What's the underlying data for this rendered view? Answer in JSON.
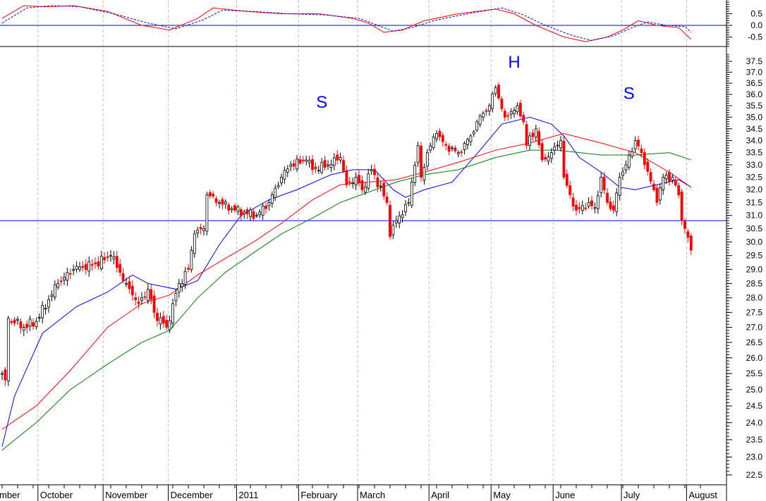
{
  "chart_data": {
    "type": "candlestick",
    "scale": "log",
    "x_unit": "trading day index (0 = mid-September 2010)",
    "months": [
      {
        "label": "mber",
        "day": -1
      },
      {
        "label": "October",
        "day": 12
      },
      {
        "label": "November",
        "day": 33
      },
      {
        "label": "December",
        "day": 54
      },
      {
        "label": "2011",
        "day": 76
      },
      {
        "label": "February",
        "day": 96
      },
      {
        "label": "March",
        "day": 115
      },
      {
        "label": "April",
        "day": 138
      },
      {
        "label": "May",
        "day": 158
      },
      {
        "label": "June",
        "day": 178
      },
      {
        "label": "July",
        "day": 200
      },
      {
        "label": "August",
        "day": 221
      }
    ],
    "price_axis": {
      "min": 22.5,
      "max": 37.5,
      "step": 0.5,
      "labels": [
        "37.5",
        "37.0",
        "36.5",
        "36.0",
        "35.5",
        "35.0",
        "34.5",
        "34.0",
        "33.5",
        "33.0",
        "32.5",
        "32.0",
        "31.5",
        "31.0",
        "30.5",
        "30.0",
        "29.5",
        "29.0",
        "28.5",
        "28.0",
        "27.5",
        "27.0",
        "26.5",
        "26.0",
        "25.5",
        "25.0",
        "24.5",
        "24.0",
        "23.5",
        "23.0",
        "22.5"
      ]
    },
    "oscillator_axis": {
      "labels": [
        "0.5",
        "0.0",
        "-0.5"
      ],
      "values": [
        0.5,
        0,
        -0.5
      ]
    },
    "support_level": 30.8,
    "close_anchors": [
      [
        0,
        25.5
      ],
      [
        1,
        25.3
      ],
      [
        2,
        27.3
      ],
      [
        7,
        27.0
      ],
      [
        11,
        27.2
      ],
      [
        18,
        28.5
      ],
      [
        23,
        29.0
      ],
      [
        30,
        29.2
      ],
      [
        35,
        29.5
      ],
      [
        40,
        28.5
      ],
      [
        44,
        27.8
      ],
      [
        47,
        28.3
      ],
      [
        49,
        27.5
      ],
      [
        53,
        27.0
      ],
      [
        55,
        27.8
      ],
      [
        57,
        28.5
      ],
      [
        60,
        29.0
      ],
      [
        62,
        30.3
      ],
      [
        65,
        30.5
      ],
      [
        66,
        31.8
      ],
      [
        70,
        31.5
      ],
      [
        75,
        31.2
      ],
      [
        82,
        31.0
      ],
      [
        86,
        31.5
      ],
      [
        90,
        32.5
      ],
      [
        93,
        33.0
      ],
      [
        98,
        33.2
      ],
      [
        100,
        32.8
      ],
      [
        105,
        33.0
      ],
      [
        109,
        33.3
      ],
      [
        111,
        32.2
      ],
      [
        114,
        32.5
      ],
      [
        116,
        32.0
      ],
      [
        119,
        32.8
      ],
      [
        124,
        31.5
      ],
      [
        125,
        30.2
      ],
      [
        127,
        30.8
      ],
      [
        131,
        31.5
      ],
      [
        132,
        32.3
      ],
      [
        134,
        33.8
      ],
      [
        135,
        32.5
      ],
      [
        137,
        33.5
      ],
      [
        140,
        34.3
      ],
      [
        143,
        33.8
      ],
      [
        147,
        33.5
      ],
      [
        151,
        34.2
      ],
      [
        153,
        34.8
      ],
      [
        157,
        35.5
      ],
      [
        159,
        36.3
      ],
      [
        162,
        35.0
      ],
      [
        166,
        35.5
      ],
      [
        168,
        34.8
      ],
      [
        169,
        33.8
      ],
      [
        172,
        34.5
      ],
      [
        174,
        33.2
      ],
      [
        177,
        33.5
      ],
      [
        180,
        34.0
      ],
      [
        181,
        32.5
      ],
      [
        183,
        31.8
      ],
      [
        185,
        31.2
      ],
      [
        189,
        31.5
      ],
      [
        191,
        31.3
      ],
      [
        193,
        32.5
      ],
      [
        195,
        31.5
      ],
      [
        197,
        31.2
      ],
      [
        199,
        32.5
      ],
      [
        201,
        33.0
      ],
      [
        204,
        34.0
      ],
      [
        206,
        33.5
      ],
      [
        207,
        33.0
      ],
      [
        210,
        32.0
      ],
      [
        211,
        31.5
      ],
      [
        213,
        32.5
      ],
      [
        216,
        32.5
      ],
      [
        218,
        31.8
      ],
      [
        219,
        30.8
      ],
      [
        220,
        30.5
      ],
      [
        222,
        29.7
      ]
    ],
    "series": [
      {
        "name": "short moving average",
        "color": "#0000ff",
        "points": [
          [
            0,
            23.3
          ],
          [
            4,
            24.8
          ],
          [
            13,
            26.8
          ],
          [
            24,
            27.7
          ],
          [
            34,
            28.2
          ],
          [
            42,
            28.8
          ],
          [
            47,
            28.5
          ],
          [
            56,
            28.3
          ],
          [
            63,
            28.6
          ],
          [
            70,
            29.9
          ],
          [
            77,
            31.0
          ],
          [
            86,
            31.6
          ],
          [
            95,
            32.0
          ],
          [
            106,
            32.6
          ],
          [
            113,
            32.8
          ],
          [
            120,
            32.8
          ],
          [
            126,
            32.0
          ],
          [
            130,
            31.7
          ],
          [
            136,
            32.0
          ],
          [
            145,
            32.3
          ],
          [
            154,
            33.6
          ],
          [
            161,
            34.7
          ],
          [
            170,
            35.0
          ],
          [
            177,
            34.7
          ],
          [
            181,
            34.2
          ],
          [
            186,
            33.3
          ],
          [
            193,
            32.7
          ],
          [
            199,
            32.1
          ],
          [
            204,
            32.0
          ],
          [
            211,
            32.2
          ],
          [
            218,
            32.4
          ],
          [
            222,
            32.1
          ]
        ]
      },
      {
        "name": "medium moving average",
        "color": "#ff0000",
        "points": [
          [
            0,
            23.8
          ],
          [
            11,
            24.5
          ],
          [
            22,
            25.6
          ],
          [
            34,
            27.0
          ],
          [
            45,
            27.8
          ],
          [
            54,
            28.1
          ],
          [
            63,
            28.8
          ],
          [
            72,
            29.4
          ],
          [
            81,
            30.0
          ],
          [
            90,
            30.7
          ],
          [
            100,
            31.6
          ],
          [
            109,
            32.2
          ],
          [
            118,
            32.3
          ],
          [
            127,
            32.4
          ],
          [
            136,
            32.7
          ],
          [
            147,
            33.1
          ],
          [
            159,
            33.6
          ],
          [
            170,
            33.9
          ],
          [
            181,
            34.3
          ],
          [
            193,
            33.9
          ],
          [
            204,
            33.5
          ],
          [
            215,
            32.7
          ],
          [
            222,
            32.1
          ]
        ]
      },
      {
        "name": "long moving average",
        "color": "#008000",
        "points": [
          [
            0,
            23.2
          ],
          [
            11,
            24.0
          ],
          [
            22,
            25.0
          ],
          [
            34,
            25.8
          ],
          [
            45,
            26.5
          ],
          [
            54,
            26.9
          ],
          [
            63,
            28.0
          ],
          [
            72,
            28.9
          ],
          [
            81,
            29.6
          ],
          [
            90,
            30.3
          ],
          [
            100,
            30.9
          ],
          [
            109,
            31.5
          ],
          [
            118,
            31.9
          ],
          [
            127,
            32.3
          ],
          [
            136,
            32.6
          ],
          [
            147,
            32.8
          ],
          [
            159,
            33.3
          ],
          [
            170,
            33.6
          ],
          [
            179,
            33.6
          ],
          [
            193,
            33.4
          ],
          [
            204,
            33.4
          ],
          [
            215,
            33.5
          ],
          [
            222,
            33.2
          ]
        ]
      }
    ],
    "oscillator": [
      {
        "name": "oscillator",
        "color": "#ff0000",
        "style": "solid",
        "points": [
          [
            0,
            0.3
          ],
          [
            7,
            0.85
          ],
          [
            14,
            0.8
          ],
          [
            23,
            0.85
          ],
          [
            34,
            0.6
          ],
          [
            45,
            0.0
          ],
          [
            54,
            -0.2
          ],
          [
            63,
            0.3
          ],
          [
            68,
            0.75
          ],
          [
            79,
            0.6
          ],
          [
            90,
            0.5
          ],
          [
            102,
            0.5
          ],
          [
            113,
            0.3
          ],
          [
            118,
            0.1
          ],
          [
            123,
            -0.3
          ],
          [
            129,
            -0.2
          ],
          [
            136,
            0.2
          ],
          [
            147,
            0.5
          ],
          [
            159,
            0.7
          ],
          [
            165,
            0.5
          ],
          [
            172,
            0.0
          ],
          [
            181,
            -0.5
          ],
          [
            188,
            -0.7
          ],
          [
            195,
            -0.5
          ],
          [
            200,
            -0.2
          ],
          [
            205,
            0.2
          ],
          [
            211,
            0.0
          ],
          [
            218,
            -0.1
          ],
          [
            222,
            -0.6
          ]
        ]
      },
      {
        "name": "signal",
        "color": "#0000ff",
        "style": "dashed",
        "points": [
          [
            0,
            0.1
          ],
          [
            8,
            0.75
          ],
          [
            16,
            0.85
          ],
          [
            25,
            0.8
          ],
          [
            36,
            0.5
          ],
          [
            47,
            0.1
          ],
          [
            56,
            -0.15
          ],
          [
            65,
            0.25
          ],
          [
            71,
            0.65
          ],
          [
            81,
            0.6
          ],
          [
            92,
            0.5
          ],
          [
            104,
            0.45
          ],
          [
            115,
            0.3
          ],
          [
            121,
            0.0
          ],
          [
            126,
            -0.25
          ],
          [
            132,
            -0.1
          ],
          [
            139,
            0.2
          ],
          [
            150,
            0.5
          ],
          [
            161,
            0.75
          ],
          [
            168,
            0.45
          ],
          [
            175,
            0.0
          ],
          [
            184,
            -0.45
          ],
          [
            190,
            -0.65
          ],
          [
            197,
            -0.45
          ],
          [
            203,
            -0.1
          ],
          [
            208,
            0.15
          ],
          [
            214,
            0.0
          ],
          [
            220,
            -0.05
          ],
          [
            222,
            -0.3
          ]
        ]
      }
    ],
    "annotations": [
      {
        "text": "S",
        "day": 103,
        "price": 35.4
      },
      {
        "text": "H",
        "day": 165,
        "price": 37.2
      },
      {
        "text": "S",
        "day": 202,
        "price": 35.8
      }
    ]
  },
  "colors": {
    "up_candle": "#ffffff",
    "down_candle": "#ff0000",
    "outline": "#000000",
    "annotation": "#0000ff",
    "grid": "#c0c0c0"
  }
}
